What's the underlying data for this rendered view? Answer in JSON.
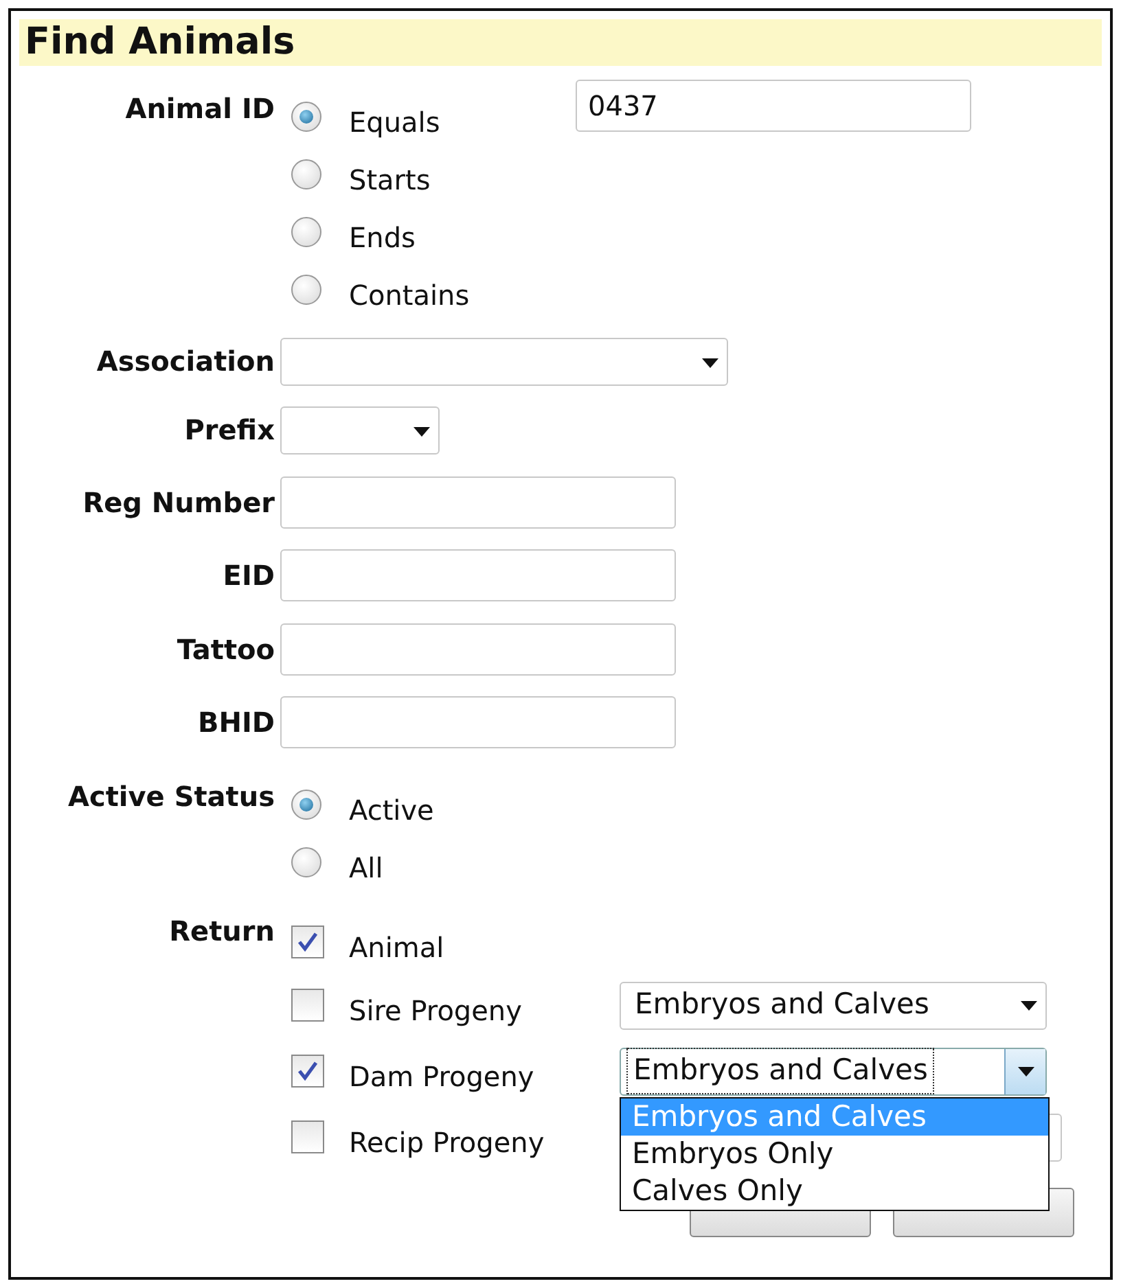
{
  "title": "Find Animals",
  "animal_id": {
    "label": "Animal ID",
    "value": "0437",
    "options": [
      {
        "label": "Equals",
        "selected": true
      },
      {
        "label": "Starts",
        "selected": false
      },
      {
        "label": "Ends",
        "selected": false
      },
      {
        "label": "Contains",
        "selected": false
      }
    ]
  },
  "fields": [
    {
      "kind": "select",
      "label": "Association"
    },
    {
      "kind": "select",
      "label": "Prefix"
    },
    {
      "kind": "text",
      "label": "Reg Number"
    },
    {
      "kind": "text",
      "label": "EID"
    },
    {
      "kind": "text",
      "label": "Tattoo"
    },
    {
      "kind": "text",
      "label": "BHID"
    }
  ],
  "active_status": {
    "label": "Active Status",
    "options": [
      {
        "label": "Active",
        "selected": true
      },
      {
        "label": "All",
        "selected": false
      }
    ]
  },
  "return": {
    "label": "Return",
    "items": [
      {
        "kind": "plain",
        "label": "Animal",
        "checked": true
      },
      {
        "kind": "select",
        "label": "Sire Progeny",
        "checked": false,
        "select": {
          "value": "Embryos and Calves",
          "focused": false
        }
      },
      {
        "kind": "select",
        "label": "Dam Progeny",
        "checked": true,
        "select": {
          "value": "Embryos and Calves",
          "focused": true,
          "options": [
            {
              "label": "Embryos and Calves",
              "selected": true
            },
            {
              "label": "Embryos Only",
              "selected": false
            },
            {
              "label": "Calves Only",
              "selected": false
            }
          ]
        }
      },
      {
        "kind": "select",
        "label": "Recip Progeny",
        "checked": false
      }
    ]
  },
  "buttons": [
    {
      "kind": "push"
    },
    {
      "kind": "push"
    }
  ]
}
